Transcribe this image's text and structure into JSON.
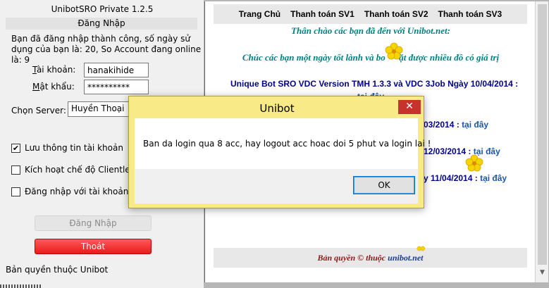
{
  "app": {
    "title": "UnibotSRO Private 1.2.5",
    "section_header": "Đăng Nhập",
    "login_message": "Bạn đã đăng nhập thành công, số ngày sử dụng của bạn là: 20, So Account đang online là: 9"
  },
  "form": {
    "username_label_u": "T",
    "username_label_rest": "ài khoản:",
    "username_value": "hanakihide",
    "password_label_u": "M",
    "password_label_rest": "ật khẩu:",
    "password_value": "**********",
    "server_label": "Chọn Server:",
    "server_value": "Huyền Thoại"
  },
  "options": [
    {
      "label": "Lưu thông tin tài khoản",
      "checked": true
    },
    {
      "label": "Kích hoạt chế độ Clientless",
      "checked": false
    },
    {
      "label": "Đăng nhập với tài khoản qu",
      "checked": false
    }
  ],
  "buttons": {
    "login": "Đăng Nhập",
    "exit": "Thoát"
  },
  "copyright_left": "Bản quyền thuộc Unibot",
  "web": {
    "nav": [
      "Trang Chủ",
      "Thanh toán SV1",
      "Thanh toán SV2",
      "Thanh toán SV3"
    ],
    "greeting": "Thân chào các bạn đã đến với Unibot.net:",
    "wish": "Chúc các bạn một ngày tốt lành và bo      ặt được nhiều đồ có giá trị",
    "news1_line1": "Unique Bot SRO VDC Version TMH 1.3.3 và VDC 3Job Ngày 10/04/2014 :",
    "news1_line2": "tại đây",
    "news2_tail": "03/2014 :",
    "news3_tail": "12/03/2014 :",
    "news4_tail": "y 11/04/2014 :",
    "link_text": "tại đây",
    "footer_text": "Bản quyền © thuộc",
    "footer_link": "unibot.net"
  },
  "dialog": {
    "title": "Unibot",
    "close": "✕",
    "message": "Ban da login qua 8 acc, hay logout acc hoac doi 5 phut va login lai !",
    "ok": "OK"
  },
  "colors": {
    "exit_button": "#e81a1a",
    "dialog_frame": "#f7ea87",
    "close_button": "#c7322d",
    "teal_text": "#008080",
    "news_text": "#00008b"
  }
}
